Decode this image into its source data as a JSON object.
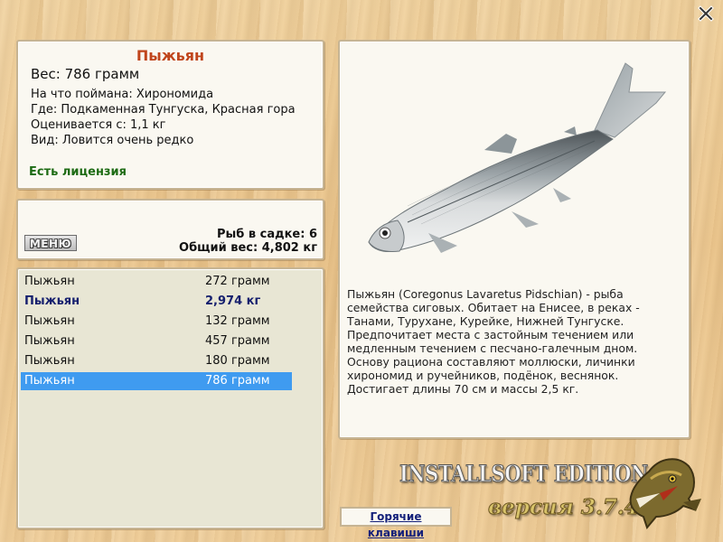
{
  "info": {
    "title": "Пыжьян",
    "weight": "Вес: 786 грамм",
    "bait": "На что поймана: Хирономида",
    "location": "Где: Подкаменная Тунгуска, Красная гора",
    "rated": "Оценивается с: 1,1 кг",
    "rarity": "Вид: Ловится очень редко",
    "license": "Есть лицензия"
  },
  "stats": {
    "menu_label": "МЕНЮ",
    "count": "Рыб в садке: 6",
    "total": "Общий вес: 4,802 кг"
  },
  "catch": [
    {
      "name": "Пыжьян",
      "weight": "272 грамм",
      "state": "normal"
    },
    {
      "name": "Пыжьян",
      "weight": "2,974 кг",
      "state": "bold"
    },
    {
      "name": "Пыжьян",
      "weight": "132 грамм",
      "state": "normal"
    },
    {
      "name": "Пыжьян",
      "weight": "457 грамм",
      "state": "normal"
    },
    {
      "name": "Пыжьян",
      "weight": "180 грамм",
      "state": "normal"
    },
    {
      "name": "Пыжьян",
      "weight": "786 грамм",
      "state": "selected"
    }
  ],
  "description": "Пыжьян (Coregonus Lavaretus Pidschian) - рыба семейства сиговых. Обитает на Енисее, в реках - Танами, Турухане, Курейке, Нижней Тунгуске. Предпочитает места с застойным течением или медленным течением с песчано-галечным дном. Основу рациона составляют моллюски, личинки хирономид и ручейников, подёнок, веснянок. Достигает длины 70 см и массы 2,5 кг.",
  "hotkeys_label": "Горячие клавиши",
  "edition": "INSTALLSOFT EDITION",
  "version": "версия 3.7.4",
  "icons": {
    "close": "close-icon",
    "fish": "fish-image",
    "logo": "pike-logo"
  },
  "colors": {
    "title": "#c0451c",
    "license": "#1d6b14",
    "selected_row": "#3f9bf0",
    "bold_row": "#16206e"
  }
}
